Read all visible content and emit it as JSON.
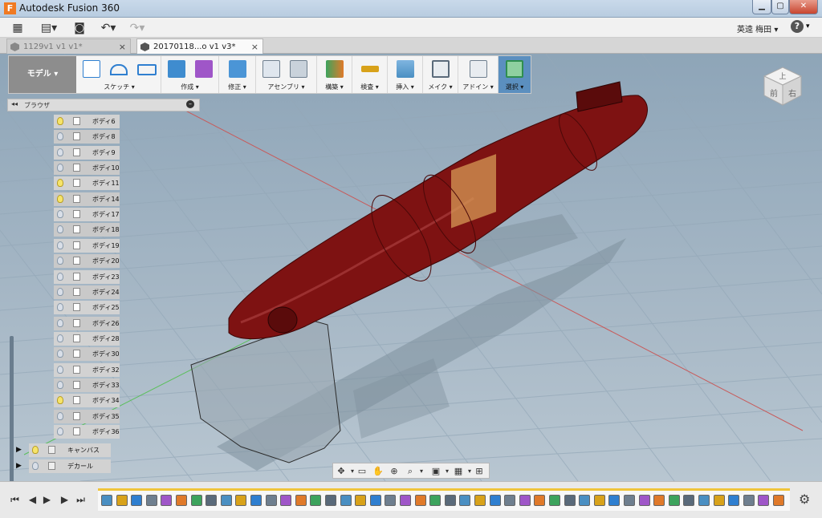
{
  "window": {
    "title": "Autodesk Fusion 360",
    "minimize": "▁",
    "maximize": "▢",
    "close": "✕"
  },
  "menubar": {
    "user": "英逵 梅田 ▾",
    "help": "?",
    "help_caret": "▾"
  },
  "tabs": [
    {
      "label": "1129v1 v1 v1*",
      "active": false
    },
    {
      "label": "20170118...o v1 v3*",
      "active": true
    }
  ],
  "toolbar": {
    "workspace": "モデル ▾",
    "groups": [
      {
        "label": "スケッチ ▾",
        "color": "#2f7fd0"
      },
      {
        "label": "作成 ▾",
        "color": "#3f8ccf"
      },
      {
        "label": "修正 ▾",
        "color": "#4b95d6"
      },
      {
        "label": "アセンブリ ▾",
        "color": "#6f7f8f"
      },
      {
        "label": "構築 ▾",
        "color": "#e07a2a"
      },
      {
        "label": "検査 ▾",
        "color": "#d8a21a"
      },
      {
        "label": "挿入 ▾",
        "color": "#4a8fc2"
      },
      {
        "label": "メイク ▾",
        "color": "#5a6a7a"
      },
      {
        "label": "アドイン ▾",
        "color": "#6f7f8f"
      },
      {
        "label": "選択 ▾",
        "color": "#2f8f4f"
      }
    ]
  },
  "browser": {
    "title": "ブラウザ",
    "bodies": [
      {
        "name": "ボディ6",
        "on": true
      },
      {
        "name": "ボディ8",
        "on": false
      },
      {
        "name": "ボディ9",
        "on": false
      },
      {
        "name": "ボディ10",
        "on": false
      },
      {
        "name": "ボディ11",
        "on": true
      },
      {
        "name": "ボディ14",
        "on": true
      },
      {
        "name": "ボディ17",
        "on": false
      },
      {
        "name": "ボディ18",
        "on": false
      },
      {
        "name": "ボディ19",
        "on": false
      },
      {
        "name": "ボディ20",
        "on": false
      },
      {
        "name": "ボディ23",
        "on": false
      },
      {
        "name": "ボディ24",
        "on": false
      },
      {
        "name": "ボディ25",
        "on": false
      },
      {
        "name": "ボディ26",
        "on": false
      },
      {
        "name": "ボディ28",
        "on": false
      },
      {
        "name": "ボディ30",
        "on": false
      },
      {
        "name": "ボディ32",
        "on": false
      },
      {
        "name": "ボディ33",
        "on": false
      },
      {
        "name": "ボディ34",
        "on": true
      },
      {
        "name": "ボディ35",
        "on": false
      },
      {
        "name": "ボディ36",
        "on": false
      }
    ],
    "folders": [
      {
        "name": "キャンバス",
        "on": true
      },
      {
        "name": "デカール",
        "on": false
      }
    ]
  },
  "viewcube": {
    "top": "上",
    "front": "前",
    "right": "右"
  },
  "colors": {
    "model": "#7e1212",
    "accent": "#f0c43a"
  }
}
